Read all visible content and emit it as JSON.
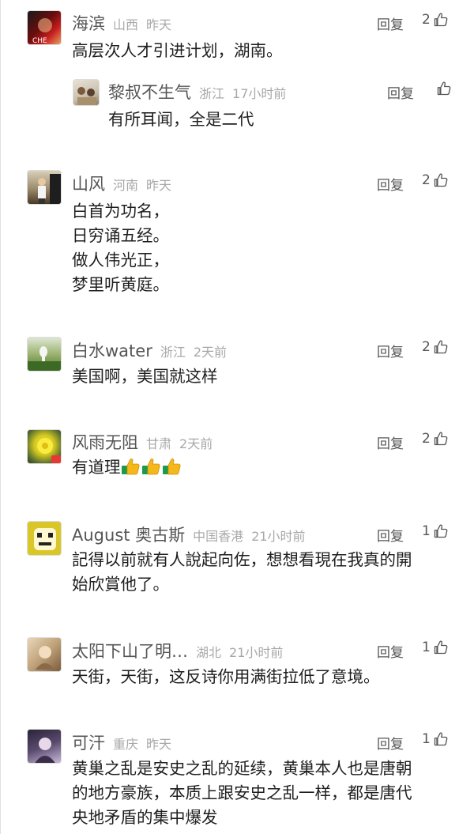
{
  "reply_label": "回复",
  "comments": [
    {
      "name": "海滨",
      "location": "山西",
      "time": "昨天",
      "likes": "2",
      "lines": [
        "高层次人才引进计划，湖南。"
      ],
      "sub": {
        "name": "黎叔不生气",
        "location": "浙江",
        "time": "17小时前",
        "likes": "",
        "lines": [
          "有所耳闻，全是二代"
        ]
      }
    },
    {
      "name": "山风",
      "location": "河南",
      "time": "昨天",
      "likes": "2",
      "lines": [
        "白首为功名，",
        "日穷诵五经。",
        "做人伟光正，",
        "梦里听黄庭。"
      ]
    },
    {
      "name": "白水water",
      "location": "浙江",
      "time": "2天前",
      "likes": "2",
      "lines": [
        "美国啊，美国就这样"
      ]
    },
    {
      "name": "风雨无阻",
      "location": "甘肃",
      "time": "2天前",
      "likes": "2",
      "lines": [
        "有道理"
      ]
    },
    {
      "name": "August 奥古斯",
      "location": "中国香港",
      "time": "21小时前",
      "likes": "1",
      "lines": [
        "記得以前就有人說起向佐，想想看現在我真的開",
        "始欣賞他了。"
      ]
    },
    {
      "name": "太阳下山了明…",
      "location": "湖北",
      "time": "21小时前",
      "likes": "1",
      "lines": [
        "天街，天街，这反诗你用满街拉低了意境。"
      ]
    },
    {
      "name": "可汗",
      "location": "重庆",
      "time": "昨天",
      "likes": "1",
      "lines": [
        "黄巢之乱是安史之乱的延续，黄巢本人也是唐朝",
        "的地方豪族，本质上跟安史之乱一样，都是唐代",
        "央地矛盾的集中爆发"
      ]
    }
  ]
}
